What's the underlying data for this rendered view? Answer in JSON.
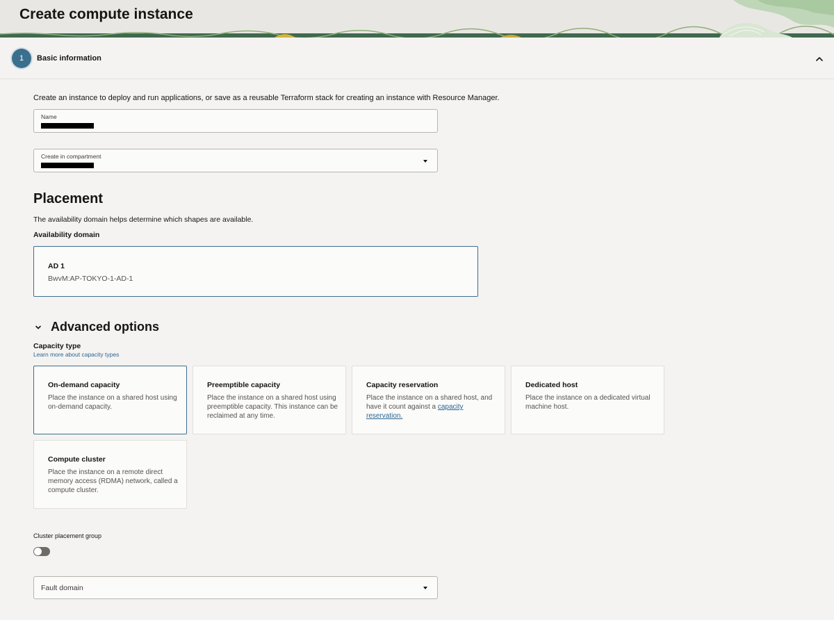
{
  "header": {
    "title": "Create compute instance"
  },
  "step": {
    "number": "1",
    "title": "Basic information"
  },
  "intro": "Create an instance to deploy and run applications, or save as a reusable Terraform stack for creating an instance with Resource Manager.",
  "fields": {
    "name_label": "Name",
    "compartment_label": "Create in compartment"
  },
  "placement": {
    "heading": "Placement",
    "description": "The availability domain helps determine which shapes are available.",
    "ad_label": "Availability domain",
    "ad_name": "AD 1",
    "ad_id": "BwvM:AP-TOKYO-1-AD-1"
  },
  "advanced": {
    "heading": "Advanced options",
    "capacity_label": "Capacity type",
    "capacity_link": "Learn more about capacity types",
    "capacity_options": [
      {
        "title": "On-demand capacity",
        "description": "Place the instance on a shared host using on-demand capacity."
      },
      {
        "title": "Preemptible capacity",
        "description": "Place the instance on a shared host using preemptible capacity. This instance can be reclaimed at any time."
      },
      {
        "title": "Capacity reservation",
        "description": "Place the instance on a shared host, and have it count against a",
        "link": "capacity reservation."
      },
      {
        "title": "Dedicated host",
        "description": "Place the instance on a dedicated virtual machine host."
      },
      {
        "title": "Compute cluster",
        "description": "Place the instance on a remote direct memory access (RDMA) network, called a compute cluster."
      }
    ],
    "cluster_group_label": "Cluster placement group",
    "fault_domain_placeholder": "Fault domain"
  },
  "colors": {
    "accent": "#3c6f8d",
    "link": "#2b6592",
    "background": "#f4f3f1"
  }
}
